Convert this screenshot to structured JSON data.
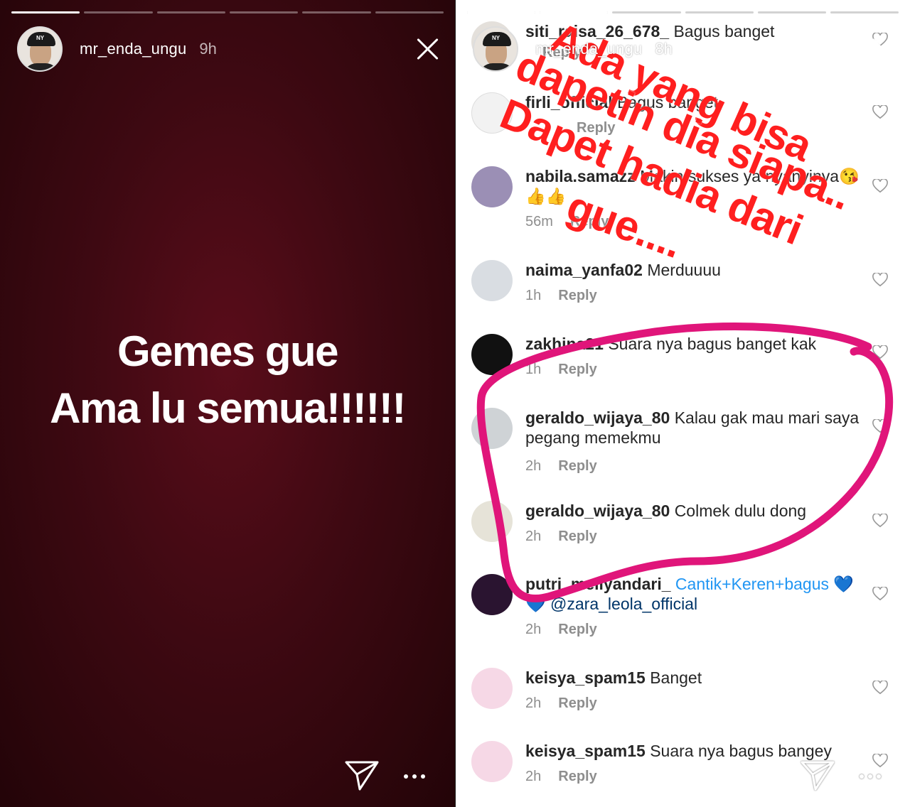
{
  "left_story": {
    "username": "mr_enda_ungu",
    "time": "9h",
    "progress_segments": [
      1.0,
      0.0,
      0.0,
      0.0,
      0.0,
      0.0
    ],
    "text_line1": "Gemes gue",
    "text_line2": "Ama lu semua!!!!!!"
  },
  "right_story": {
    "username": "mr_enda_ungu",
    "time": "8h",
    "progress_segments": [
      1.0,
      1.0,
      0.0,
      0.0,
      0.0,
      0.0
    ],
    "overlay_lines": [
      "Ada yang bisa",
      "dapetin dia siapa..",
      "Dapet hadia dari",
      "gue...."
    ],
    "overlay_color": "#ff1f1f",
    "circle_color": "#e0157a",
    "comments": [
      {
        "user": "siti_raisa_26_678_",
        "text": "Bagus banget",
        "time": "",
        "reply": "Reply"
      },
      {
        "user": "firli_official",
        "text": "Bagus banget",
        "time": "",
        "reply": "Reply"
      },
      {
        "user": "nabila.samazz",
        "text": "Makin sukses ya nyanyinya😘👍👍",
        "time": "56m",
        "reply": "Reply"
      },
      {
        "user": "naima_yanfa02",
        "text": "Merduuuu",
        "time": "1h",
        "reply": "Reply"
      },
      {
        "user": "zakhina21",
        "text": "Suara nya bagus banget kak",
        "time": "1h",
        "reply": "Reply"
      },
      {
        "user": "geraldo_wijaya_80",
        "text": "Kalau gak mau mari saya pegang memekmu",
        "time": "2h",
        "reply": "Reply"
      },
      {
        "user": "geraldo_wijaya_80",
        "text": "Colmek dulu dong",
        "time": "2h",
        "reply": "Reply"
      },
      {
        "user": "putri_meilyandari_",
        "text": "Cantik+Keren+bagus 💙 💙",
        "mention": "@zara_leola_official",
        "time": "2h",
        "reply": "Reply"
      },
      {
        "user": "keisya_spam15",
        "text": "Banget",
        "time": "2h",
        "reply": "Reply"
      },
      {
        "user": "keisya_spam15",
        "text": "Suara nya bagus bangey",
        "time": "2h",
        "reply": "Reply"
      }
    ]
  },
  "icons": {
    "close": "close-icon",
    "send": "paper-plane-icon",
    "more": "more-dots-icon",
    "heart": "heart-outline-icon"
  }
}
